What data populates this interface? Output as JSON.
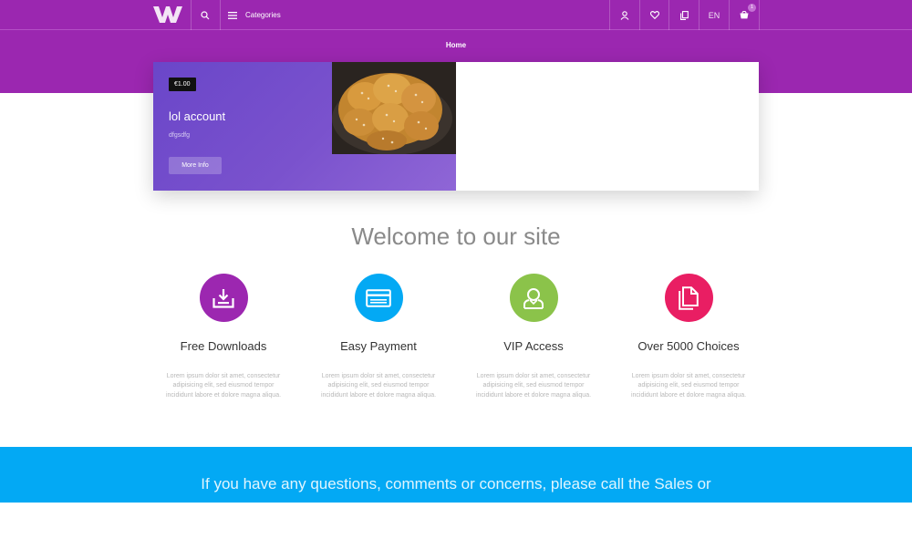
{
  "header": {
    "categories_label": "Categories",
    "language": "EN",
    "cart_count": "1",
    "icons": [
      "logo-w",
      "search-icon",
      "menu-icon",
      "user-icon",
      "heart-icon",
      "compare-icon",
      "cart-icon"
    ]
  },
  "breadcrumb": {
    "home": "Home"
  },
  "product": {
    "price": "€1.00",
    "title": "lol account",
    "subtitle": "dfgsdfg",
    "more_info": "More Info"
  },
  "welcome": {
    "title": "Welcome to our site"
  },
  "features": [
    {
      "title": "Free Downloads",
      "color": "#9c27b0",
      "icon": "download-icon",
      "desc": "Lorem ipsum dolor sit amet, consectetur adipisicing elit, sed eiusmod tempor incididunt labore et dolore magna aliqua."
    },
    {
      "title": "Easy Payment",
      "color": "#03a9f4",
      "icon": "credit-card-icon",
      "desc": "Lorem ipsum dolor sit amet, consectetur adipisicing elit, sed eiusmod tempor incididunt labore et dolore magna aliqua."
    },
    {
      "title": "VIP Access",
      "color": "#8bc34a",
      "icon": "user-badge-icon",
      "desc": "Lorem ipsum dolor sit amet, consectetur adipisicing elit, sed eiusmod tempor incididunt labore et dolore magna aliqua."
    },
    {
      "title": "Over 5000 Choices",
      "color": "#e91e63",
      "icon": "file-icon",
      "desc": "Lorem ipsum dolor sit amet, consectetur adipisicing elit, sed eiusmod tempor incididunt labore et dolore magna aliqua."
    }
  ],
  "contact": {
    "line1": "If you have any questions, comments or concerns, please call the Sales or"
  },
  "colors": {
    "brand": "#9b27b0",
    "accent": "#03a9f4"
  }
}
